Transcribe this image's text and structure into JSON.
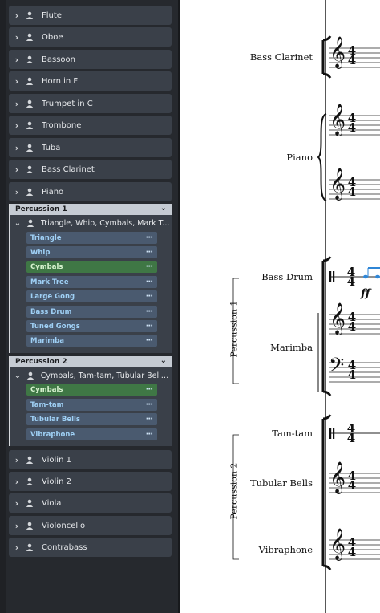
{
  "players_top": [
    "Flute",
    "Oboe",
    "Bassoon",
    "Horn in F",
    "Trumpet in C",
    "Trombone",
    "Tuba",
    "Bass Clarinet",
    "Piano"
  ],
  "percussion1": {
    "header": "Percussion 1",
    "player": "Triangle, Whip, Cymbals, Mark Tree, La...",
    "instruments": [
      "Triangle",
      "Whip",
      "Cymbals",
      "Mark Tree",
      "Large Gong",
      "Bass Drum",
      "Tuned Gongs",
      "Marimba"
    ],
    "selected_index": 2
  },
  "percussion2": {
    "header": "Percussion 2",
    "player": "Cymbals, Tam-tam, Tubular Bells & Vib...",
    "instruments": [
      "Cymbals",
      "Tam-tam",
      "Tubular Bells",
      "Vibraphone"
    ],
    "selected_index": 0
  },
  "players_bottom": [
    "Violin 1",
    "Violin 2",
    "Viola",
    "Violoncello",
    "Contrabass"
  ],
  "more_glyph": "···",
  "score": {
    "staff_names": {
      "bass_clarinet": "Bass Clarinet",
      "piano": "Piano",
      "bass_drum": "Bass Drum",
      "marimba": "Marimba",
      "tam_tam": "Tam-tam",
      "tubular_bells": "Tubular Bells",
      "vibraphone": "Vibraphone"
    },
    "group_names": {
      "percussion1": "Percussion 1",
      "percussion2": "Percussion 2"
    },
    "time_signature": "4",
    "dynamic": "ff"
  },
  "colors": {
    "row_bg": "#3a4049",
    "instrument_bg": "#4a5a6f",
    "instrument_text": "#9fd0f5",
    "selected_bg": "#3f7745",
    "group_header_bg": "#c5cbd3",
    "note_accent": "#2f86d6"
  }
}
